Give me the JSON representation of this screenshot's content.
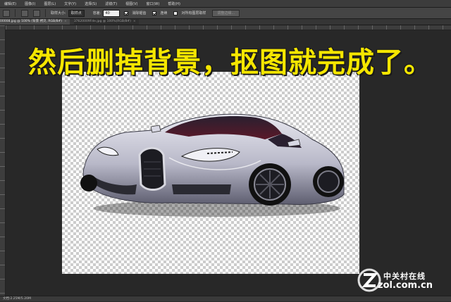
{
  "menu": {
    "items": [
      "编辑(E)",
      "图像(I)",
      "图层(L)",
      "文字(Y)",
      "选择(S)",
      "滤镜(T)",
      "视图(V)",
      "窗口(W)",
      "帮助(H)"
    ]
  },
  "options": {
    "size_label": "取样大小:",
    "size_value": "取样点",
    "tolerance_label": "容差:",
    "tolerance_value": "40",
    "antialias_label": "消除锯齿",
    "contiguous_label": "连续",
    "all_layers_label": "对所有图层取样",
    "refine_button": "调整边缘..."
  },
  "tabs": [
    {
      "label": "00008.jpg @ 100% (背景 拷贝, RGB/8#)",
      "close": "×",
      "active": true
    },
    {
      "label": "37620009Fde.jpg @ 100%(RGB/8#)",
      "close": "×",
      "active": false
    }
  ],
  "caption": "然后删掉背景，抠图就完成了。",
  "watermark": {
    "brand_cn": "中关村在线",
    "url": "zol.com.cn"
  },
  "status": {
    "doc_size": "文档:2.25M/5.20M"
  },
  "colors": {
    "caption": "#f5e600",
    "workspace": "#282828",
    "car_body": "#c8c8d4"
  }
}
